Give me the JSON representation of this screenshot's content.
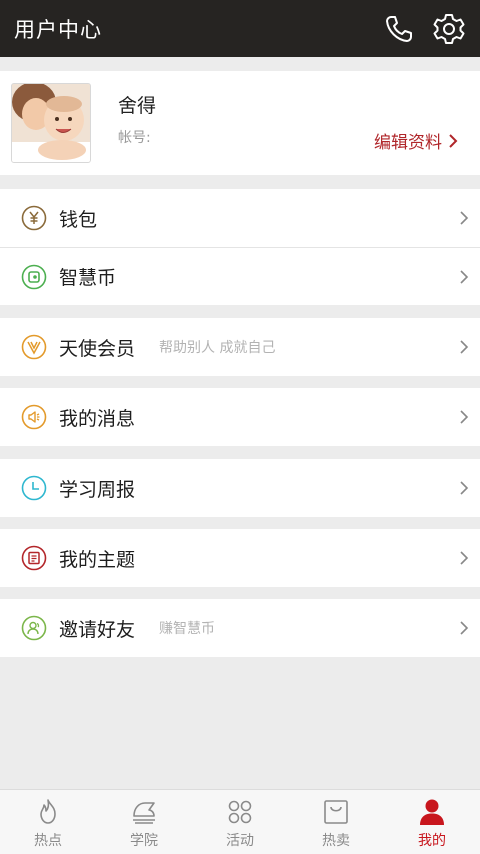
{
  "header": {
    "title": "用户中心",
    "icons": [
      "phone-icon",
      "settings-icon"
    ]
  },
  "profile": {
    "name": "舍得",
    "account_label": "帐号:",
    "edit_label": "编辑资料"
  },
  "menu": [
    {
      "label": "钱包",
      "sub": "",
      "icon": "wallet-yen-icon",
      "color": "#8a6a3a"
    },
    {
      "label": "智慧币",
      "sub": "",
      "icon": "coin-icon",
      "color": "#4caf50"
    },
    {
      "label": "天使会员",
      "sub": "帮助别人 成就自己",
      "icon": "angel-v-icon",
      "color": "#e39a2b"
    },
    {
      "label": "我的消息",
      "sub": "",
      "icon": "speaker-icon",
      "color": "#e39a2b"
    },
    {
      "label": "学习周报",
      "sub": "",
      "icon": "clock-icon",
      "color": "#2eb7cf"
    },
    {
      "label": "我的主题",
      "sub": "",
      "icon": "topic-icon",
      "color": "#b3262a"
    },
    {
      "label": "邀请好友",
      "sub": "赚智慧币",
      "icon": "friends-icon",
      "color": "#7bb64a"
    }
  ],
  "tabs": [
    {
      "label": "热点",
      "icon": "flame-icon",
      "active": false
    },
    {
      "label": "学院",
      "icon": "academy-icon",
      "active": false
    },
    {
      "label": "活动",
      "icon": "activity-icon",
      "active": false
    },
    {
      "label": "热卖",
      "icon": "bag-icon",
      "active": false
    },
    {
      "label": "我的",
      "icon": "user-icon",
      "active": true
    }
  ],
  "colors": {
    "header_bg": "#262422",
    "accent_red": "#b0262a",
    "active_tab": "#c8161d"
  }
}
